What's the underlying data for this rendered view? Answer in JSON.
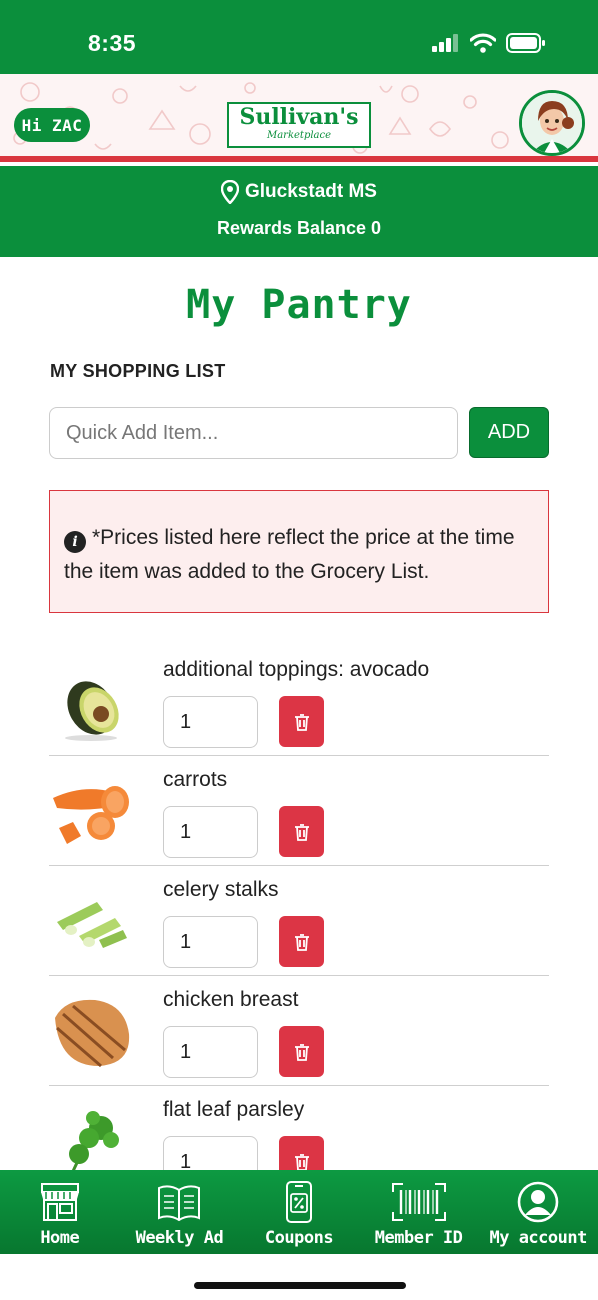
{
  "status_bar": {
    "time": "8:35"
  },
  "header": {
    "greeting": "Hi ZAC",
    "logo_main": "Sullivan's",
    "logo_sub": "Marketplace",
    "accent_color": "#0b8f3c",
    "stripe_color": "#d9363e"
  },
  "store": {
    "location": "Gluckstadt MS",
    "rewards": "Rewards Balance 0"
  },
  "page": {
    "title": "My Pantry",
    "section_label": "MY SHOPPING LIST"
  },
  "quick_add": {
    "placeholder": "Quick Add Item...",
    "button": "ADD"
  },
  "notice": {
    "text": "*Prices listed here reflect the price at the time the item was added to the Grocery List."
  },
  "items": [
    {
      "name": "additional toppings: avocado",
      "qty": "1",
      "image": "avocado"
    },
    {
      "name": "carrots",
      "qty": "1",
      "image": "carrots"
    },
    {
      "name": "celery stalks",
      "qty": "1",
      "image": "celery"
    },
    {
      "name": "chicken breast",
      "qty": "1",
      "image": "chicken-breast"
    },
    {
      "name": "flat leaf parsley",
      "qty": "1",
      "image": "parsley"
    }
  ],
  "nav": [
    {
      "label": "Home",
      "icon": "store-icon"
    },
    {
      "label": "Weekly Ad",
      "icon": "newspaper-icon"
    },
    {
      "label": "Coupons",
      "icon": "phone-coupon-icon"
    },
    {
      "label": "Member ID",
      "icon": "barcode-icon"
    },
    {
      "label": "My account",
      "icon": "user-icon"
    }
  ]
}
